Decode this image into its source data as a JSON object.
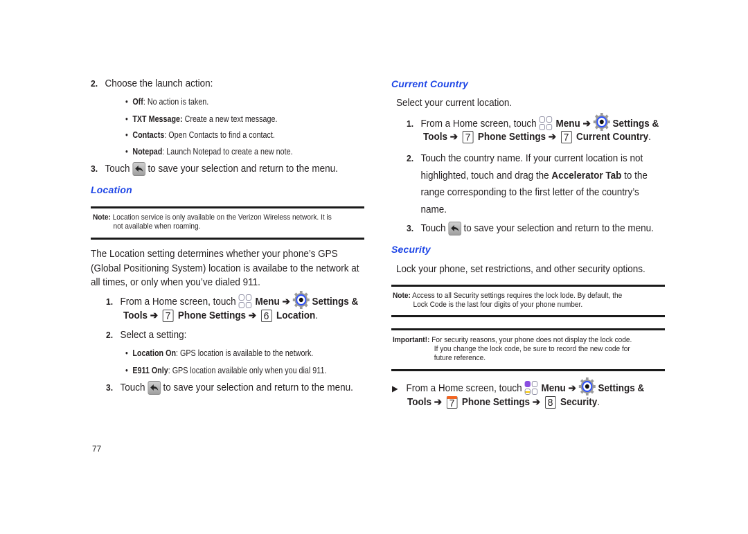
{
  "page_number": "77",
  "left": {
    "step2_launch": {
      "num": "2.",
      "text": "Choose the launch action:"
    },
    "launch_options": [
      {
        "label": "Off",
        "sep": ": ",
        "desc": "No action is taken."
      },
      {
        "label": "TXT Message:",
        "sep": " ",
        "desc": "Create a new text message."
      },
      {
        "label": "Contacts",
        "sep": ": ",
        "desc": "Open Contacts to find a contact."
      },
      {
        "label": "Notepad",
        "sep": ": ",
        "desc": "Launch Notepad to create a new note."
      }
    ],
    "step3_launch": {
      "num": "3.",
      "pre": "Touch",
      "post": "to save your selection and return to the menu."
    },
    "location_heading": "Location",
    "location_note": {
      "label": "Note:",
      "line1": "Location service is only available on the Verizon Wireless network. It is",
      "line2": "not available when roaming."
    },
    "location_intro": [
      "The Location setting determines whether your phone’s GPS",
      "(Global Positioning System) location is availabe to the network at",
      "all times, or only when you’ve dialed 911."
    ],
    "location_step1": {
      "num": "1.",
      "pre": "From a Home screen, touch",
      "menu": "Menu",
      "arrow": "➔",
      "settings": "Settings &",
      "tools": "Tools",
      "key1": "7",
      "phone_settings": "Phone Settings",
      "key2": "6",
      "target": "Location",
      "end": "."
    },
    "location_step2": {
      "num": "2.",
      "text": "Select a setting:"
    },
    "location_options": [
      {
        "label": "Location On",
        "sep": ": ",
        "desc": "GPS location is available to the network."
      },
      {
        "label": "E911 Only",
        "sep": ": ",
        "desc": "GPS location available only when you dial 911."
      }
    ],
    "location_step3": {
      "num": "3.",
      "pre": "Touch",
      "post": "to save your selection and return to the menu."
    }
  },
  "right": {
    "country_heading": "Current Country",
    "country_intro": "Select your current location.",
    "country_step1": {
      "num": "1.",
      "pre": "From a Home screen, touch",
      "menu": "Menu",
      "arrow": "➔",
      "settings": "Settings &",
      "tools": "Tools",
      "key1": "7",
      "phone_settings": "Phone Settings",
      "key2": "7",
      "target": "Current Country",
      "end": "."
    },
    "country_step2": {
      "num": "2.",
      "line1": "Touch the country name.  If your current location is not",
      "line2_pre": "highlighted, touch and drag the ",
      "line2_bold": "Accelerator Tab",
      "line2_post": " to the",
      "line3": "range corresponding to the first letter of the country’s",
      "line4": "name."
    },
    "country_step3": {
      "num": "3.",
      "pre": "Touch",
      "post": "to save your selection and return to the menu."
    },
    "security_heading": "Security",
    "security_intro": "Lock your phone, set restrictions, and other security options.",
    "security_note": {
      "label": "Note:",
      "line1": "Access to all Security settings requires the lock lode.  By default, the",
      "line2": "Lock Code is the last four digits of your phone number."
    },
    "security_important": {
      "label": "Important!:",
      "line1": "For security reasons, your phone does not display the lock code.",
      "line2": "If you change the lock code, be sure to record the new code for",
      "line3": "future reference."
    },
    "security_step": {
      "bullet": "▶",
      "pre": "From a Home screen, touch",
      "menu": "Menu",
      "arrow": "➔",
      "settings": "Settings &",
      "tools": "Tools",
      "key1": "7",
      "phone_settings": "Phone Settings",
      "key2": "8",
      "target": "Security",
      "end": "."
    }
  },
  "icons": {
    "back": "back-arrow-icon",
    "menu": "menu-grid-icon",
    "settings": "settings-gear-icon",
    "key": "keypad-key-icon"
  },
  "colors": {
    "heading": "#1e46e6",
    "text": "#231f20",
    "rule": "#1a1a1a",
    "key_highlight": "#f26522",
    "menu_highlight_purple": "#8a4fe0",
    "menu_highlight_yellow": "#f5c400"
  }
}
